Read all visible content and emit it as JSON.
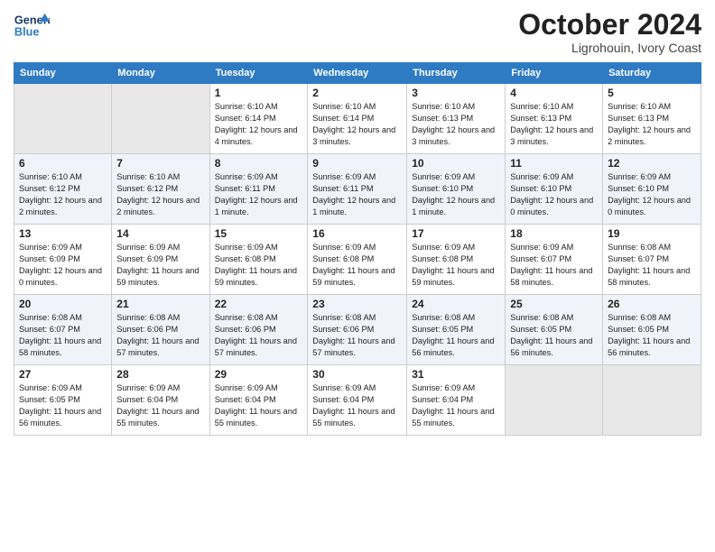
{
  "logo": {
    "general": "General",
    "blue": "Blue"
  },
  "title": "October 2024",
  "subtitle": "Ligrohouin, Ivory Coast",
  "weekdays": [
    "Sunday",
    "Monday",
    "Tuesday",
    "Wednesday",
    "Thursday",
    "Friday",
    "Saturday"
  ],
  "weeks": [
    [
      {
        "day": "",
        "info": ""
      },
      {
        "day": "",
        "info": ""
      },
      {
        "day": "1",
        "info": "Sunrise: 6:10 AM\nSunset: 6:14 PM\nDaylight: 12 hours and 4 minutes."
      },
      {
        "day": "2",
        "info": "Sunrise: 6:10 AM\nSunset: 6:14 PM\nDaylight: 12 hours and 3 minutes."
      },
      {
        "day": "3",
        "info": "Sunrise: 6:10 AM\nSunset: 6:13 PM\nDaylight: 12 hours and 3 minutes."
      },
      {
        "day": "4",
        "info": "Sunrise: 6:10 AM\nSunset: 6:13 PM\nDaylight: 12 hours and 3 minutes."
      },
      {
        "day": "5",
        "info": "Sunrise: 6:10 AM\nSunset: 6:13 PM\nDaylight: 12 hours and 2 minutes."
      }
    ],
    [
      {
        "day": "6",
        "info": "Sunrise: 6:10 AM\nSunset: 6:12 PM\nDaylight: 12 hours and 2 minutes."
      },
      {
        "day": "7",
        "info": "Sunrise: 6:10 AM\nSunset: 6:12 PM\nDaylight: 12 hours and 2 minutes."
      },
      {
        "day": "8",
        "info": "Sunrise: 6:09 AM\nSunset: 6:11 PM\nDaylight: 12 hours and 1 minute."
      },
      {
        "day": "9",
        "info": "Sunrise: 6:09 AM\nSunset: 6:11 PM\nDaylight: 12 hours and 1 minute."
      },
      {
        "day": "10",
        "info": "Sunrise: 6:09 AM\nSunset: 6:10 PM\nDaylight: 12 hours and 1 minute."
      },
      {
        "day": "11",
        "info": "Sunrise: 6:09 AM\nSunset: 6:10 PM\nDaylight: 12 hours and 0 minutes."
      },
      {
        "day": "12",
        "info": "Sunrise: 6:09 AM\nSunset: 6:10 PM\nDaylight: 12 hours and 0 minutes."
      }
    ],
    [
      {
        "day": "13",
        "info": "Sunrise: 6:09 AM\nSunset: 6:09 PM\nDaylight: 12 hours and 0 minutes."
      },
      {
        "day": "14",
        "info": "Sunrise: 6:09 AM\nSunset: 6:09 PM\nDaylight: 11 hours and 59 minutes."
      },
      {
        "day": "15",
        "info": "Sunrise: 6:09 AM\nSunset: 6:08 PM\nDaylight: 11 hours and 59 minutes."
      },
      {
        "day": "16",
        "info": "Sunrise: 6:09 AM\nSunset: 6:08 PM\nDaylight: 11 hours and 59 minutes."
      },
      {
        "day": "17",
        "info": "Sunrise: 6:09 AM\nSunset: 6:08 PM\nDaylight: 11 hours and 59 minutes."
      },
      {
        "day": "18",
        "info": "Sunrise: 6:09 AM\nSunset: 6:07 PM\nDaylight: 11 hours and 58 minutes."
      },
      {
        "day": "19",
        "info": "Sunrise: 6:08 AM\nSunset: 6:07 PM\nDaylight: 11 hours and 58 minutes."
      }
    ],
    [
      {
        "day": "20",
        "info": "Sunrise: 6:08 AM\nSunset: 6:07 PM\nDaylight: 11 hours and 58 minutes."
      },
      {
        "day": "21",
        "info": "Sunrise: 6:08 AM\nSunset: 6:06 PM\nDaylight: 11 hours and 57 minutes."
      },
      {
        "day": "22",
        "info": "Sunrise: 6:08 AM\nSunset: 6:06 PM\nDaylight: 11 hours and 57 minutes."
      },
      {
        "day": "23",
        "info": "Sunrise: 6:08 AM\nSunset: 6:06 PM\nDaylight: 11 hours and 57 minutes."
      },
      {
        "day": "24",
        "info": "Sunrise: 6:08 AM\nSunset: 6:05 PM\nDaylight: 11 hours and 56 minutes."
      },
      {
        "day": "25",
        "info": "Sunrise: 6:08 AM\nSunset: 6:05 PM\nDaylight: 11 hours and 56 minutes."
      },
      {
        "day": "26",
        "info": "Sunrise: 6:08 AM\nSunset: 6:05 PM\nDaylight: 11 hours and 56 minutes."
      }
    ],
    [
      {
        "day": "27",
        "info": "Sunrise: 6:09 AM\nSunset: 6:05 PM\nDaylight: 11 hours and 56 minutes."
      },
      {
        "day": "28",
        "info": "Sunrise: 6:09 AM\nSunset: 6:04 PM\nDaylight: 11 hours and 55 minutes."
      },
      {
        "day": "29",
        "info": "Sunrise: 6:09 AM\nSunset: 6:04 PM\nDaylight: 11 hours and 55 minutes."
      },
      {
        "day": "30",
        "info": "Sunrise: 6:09 AM\nSunset: 6:04 PM\nDaylight: 11 hours and 55 minutes."
      },
      {
        "day": "31",
        "info": "Sunrise: 6:09 AM\nSunset: 6:04 PM\nDaylight: 11 hours and 55 minutes."
      },
      {
        "day": "",
        "info": ""
      },
      {
        "day": "",
        "info": ""
      }
    ]
  ]
}
